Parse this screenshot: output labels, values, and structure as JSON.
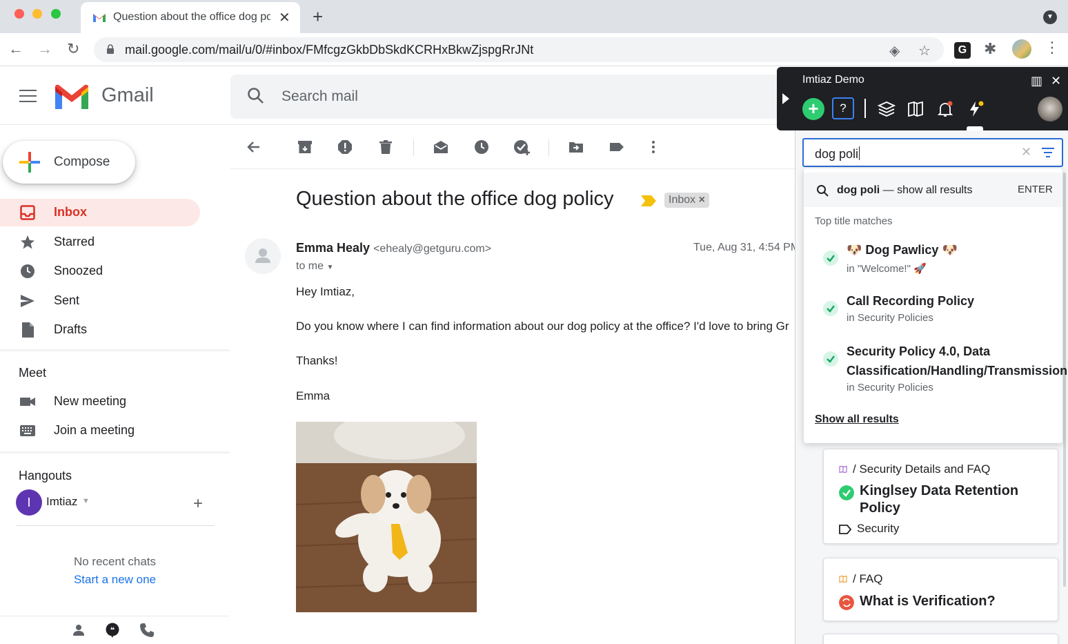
{
  "browser": {
    "tab_title": "Question about the office dog policy",
    "url": "mail.google.com/mail/u/0/#inbox/FMfcgzGkbDbSkdKCRHxBkwZjspgRrJNt",
    "new_tab": "+",
    "tab_close": "✕"
  },
  "gmail": {
    "brand": "Gmail",
    "search_placeholder": "Search mail",
    "compose_label": "Compose",
    "nav": [
      {
        "label": "Inbox",
        "icon": "inbox-icon",
        "active": true
      },
      {
        "label": "Starred",
        "icon": "star-icon"
      },
      {
        "label": "Snoozed",
        "icon": "clock-icon"
      },
      {
        "label": "Sent",
        "icon": "send-icon"
      },
      {
        "label": "Drafts",
        "icon": "draft-icon"
      }
    ],
    "meet": {
      "heading": "Meet",
      "items": [
        {
          "label": "New meeting",
          "icon": "video-camera-icon"
        },
        {
          "label": "Join a meeting",
          "icon": "keyboard-icon"
        }
      ]
    },
    "hangouts": {
      "heading": "Hangouts",
      "user_initial": "I",
      "user_name": "Imtiaz",
      "no_chats": "No recent chats",
      "start_new": "Start a new one"
    }
  },
  "email": {
    "subject": "Question about the office dog policy",
    "label_chip": "Inbox",
    "label_chip_close": "×",
    "sender_name": "Emma Healy",
    "sender_email": "<ehealy@getguru.com>",
    "recipient": "to me",
    "date": "Tue, Aug 31, 4:54 PM",
    "body": [
      "Hey Imtiaz,",
      "Do you know where I can find information about our dog policy at the office? I'd love to bring Gr",
      "Thanks!",
      "Emma"
    ]
  },
  "guru": {
    "workspace": "Imtiaz Demo",
    "help_label": "?",
    "plus_label": "+",
    "search_value": "dog poli",
    "dropdown": {
      "query": "dog poli",
      "show_all_suffix": "— show all results",
      "enter_hint": "ENTER",
      "section": "Top title matches",
      "results": [
        {
          "title": "🐶 Dog Pawlicy 🐶",
          "collection": "in \"Welcome!\" 🚀"
        },
        {
          "title": "Call Recording Policy",
          "collection": "in Security Policies"
        },
        {
          "title_line1": "Security Policy 4.0, Data",
          "title_line2": "Classification/Handling/Transmission",
          "collection": "in Security Policies"
        }
      ],
      "show_all_link": "Show all results"
    },
    "cards": [
      {
        "collection": "/ Security Details and FAQ",
        "title": "Kinglsey Data Retention Policy",
        "tag": "Security",
        "status": "verified"
      },
      {
        "collection": "/ FAQ",
        "title": "What is Verification?",
        "status": "needs-verification"
      }
    ],
    "colors": {
      "verified": "#2ecc71",
      "unverified": "#e8553e",
      "accent": "#2a6cd8"
    }
  }
}
